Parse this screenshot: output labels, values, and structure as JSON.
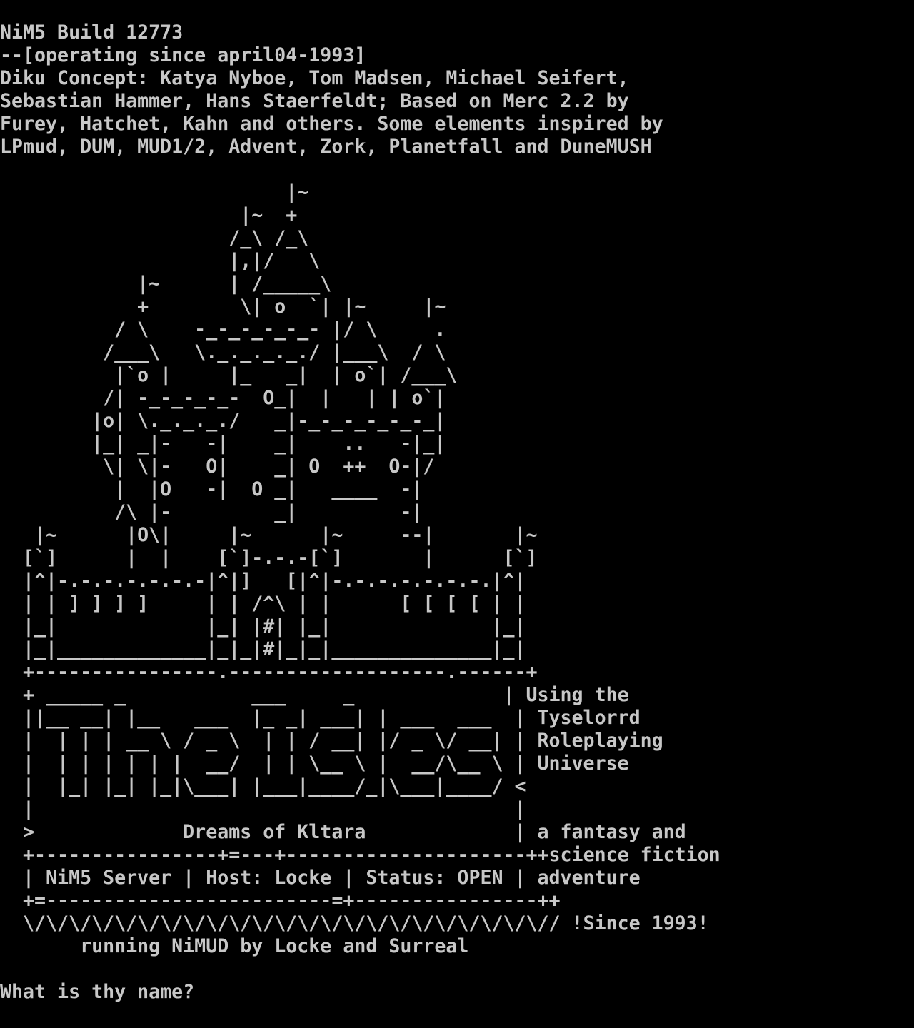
{
  "header": {
    "line_1": "NiM5 Build 12773",
    "line_2": "--[operating since april04-1993]",
    "line_3": "Diku Concept: Katya Nyboe, Tom Madsen, Michael Seifert,",
    "line_4": "Sebastian Hammer, Hans Staerfeldt; Based on Merc 2.2 by",
    "line_5": "Furey, Hatchet, Kahn and others. Some elements inspired by",
    "line_6": "LPmud, DUM, MUD1/2, Advent, Zork, Planetfall and DuneMUSH"
  },
  "castle_art": [
    "                         |~",
    "                     |~  +",
    "                    /_\\ /_\\",
    "                    |,|/   \\",
    "            |~      | /_____\\",
    "            +        \\| o  `| |~     |~",
    "          / \\    -_-_-_-_-_- |/ \\     .",
    "         /___\\   \\._._._._./ |___\\  / \\",
    "          |`o |     |_   _|  | o`| /___\\",
    "         /| -_-_-_-_-  O_|  |   | | o`|",
    "        |o| \\._._._./   _|-_-_-_-_-_-_|",
    "        |_| _|-   -|    _|    ..   -|_|",
    "         \\| \\|-   O|    _| O  ++  O-|/",
    "          |  |O   -|  O _|   ____  -|",
    "          /\\ |-         _|         -|",
    "   |~      |O\\|     |~      |~     --|       |~",
    "  [`]      |  |    [`]-.-.-[`]       |      [`]",
    "  |^|-.-.-.-.-.-.-|^|]   [|^|-.-.-.-.-.-.-.|^|",
    "  | | ] ] ] ]     | | /^\\ | |      [ [ [ [ | |",
    "  |_|             |_| |#| |_|              |_|",
    "  |_|_____________|_|_|#|_|_|______________|_|",
    "  +----------------.-------------------.------+"
  ],
  "logo_box": {
    "lines": [
      "  + _____ _           ___     _             |",
      "  ||__ __| |__   ___  |_ _| ___| | ___  ___  |",
      "  |  | | | __ \\ / _ \\  | | / __| |/ _ \\/ __| |",
      "  |  | | | | | |  __/  | | \\__ \\ |  __/\\__ \\ |",
      "  |  |_| |_| |_|\\___| |___|____/_|\\___|____/ <",
      "  |                                          |",
      "  >             Dreams of Kltara             |",
      "  +----------------+=---+---------------------++",
      "  | NiM5 Server | Host: Locke | Status: OPEN |",
      "  +=-------------------------=+----------------++",
      "  \\/\\/\\/\\/\\/\\/\\/\\/\\/\\/\\/\\/\\/\\/\\/\\/\\/\\/\\/\\/\\/\\/\\//",
      "       running NiMUD by Locke and Surreal"
    ],
    "side_text": [
      "Using the",
      "Tyselorrd",
      "Roleplaying",
      "Universe",
      "",
      "",
      "a fantasy and",
      "science fiction",
      "adventure",
      "",
      "!Since 1993!",
      ""
    ]
  },
  "prompt": {
    "text": "What is thy name?"
  }
}
